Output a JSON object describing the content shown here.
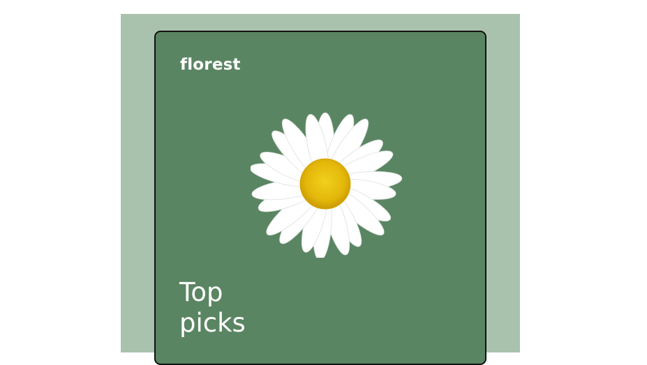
{
  "page": {
    "background": "#ffffff",
    "backdrop_color": "#a9c2ae"
  },
  "card": {
    "background": "#5a8562",
    "border_color": "#111111",
    "brand": "florest",
    "image_icon": "daisy-flower",
    "headline_line1": "Top",
    "headline_line2": "picks"
  }
}
